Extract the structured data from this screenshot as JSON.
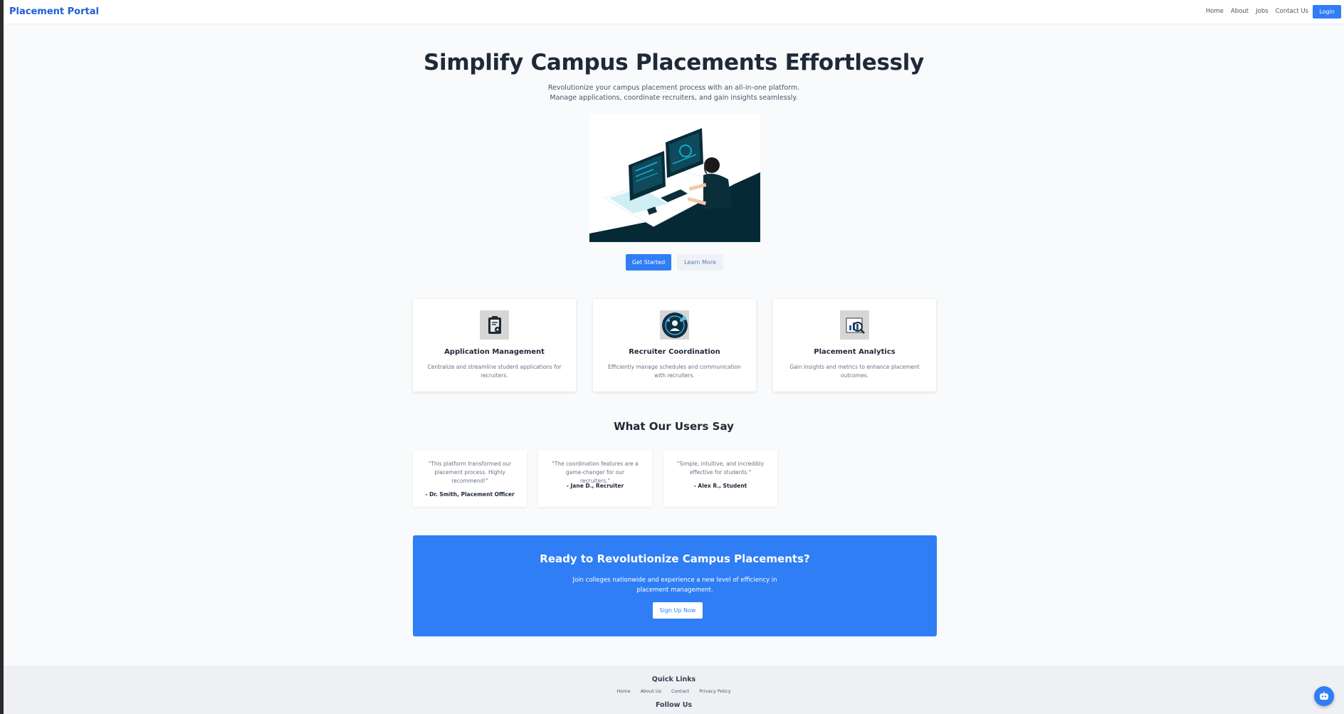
{
  "navbar": {
    "brand": "Placement Portal",
    "links": [
      "Home",
      "About",
      "Jobs",
      "Contact Us"
    ],
    "login_label": "Login"
  },
  "hero": {
    "title": "Simplify Campus Placements Effortlessly",
    "subtitle_line1": "Revolutionize your campus placement process with an all-in-one platform.",
    "subtitle_line2": "Manage applications, coordinate recruiters, and gain insights seamlessly.",
    "primary_button": "Get Started",
    "secondary_button": "Learn More"
  },
  "features": [
    {
      "title": "Application Management",
      "description": "Centralize and streamline student applications for recruiters.",
      "icon": "clipboard-icon"
    },
    {
      "title": "Recruiter Coordination",
      "description": "Efficiently manage schedules and communication with recruiters.",
      "icon": "recruiter-coordination-icon"
    },
    {
      "title": "Placement Analytics",
      "description": "Gain insights and metrics to enhance placement outcomes.",
      "icon": "analytics-icon"
    }
  ],
  "testimonials": {
    "title": "What Our Users Say",
    "items": [
      {
        "quote": "\"This platform transformed our placement process. Highly recommend!\"",
        "author": "- Dr. Smith, Placement Officer"
      },
      {
        "quote": "\"The coordination features are a game-changer for our recruiters.\"",
        "author": "- Jane D., Recruiter"
      },
      {
        "quote": "\"Simple, intuitive, and incredibly effective for students.\"",
        "author": "- Alex R., Student"
      }
    ]
  },
  "cta": {
    "title": "Ready to Revolutionize Campus Placements?",
    "subtitle": "Join colleges nationwide and experience a new level of efficiency in placement management.",
    "button": "Sign Up Now"
  },
  "footer": {
    "quick_links_title": "Quick Links",
    "links": [
      "Home",
      "About Us",
      "Contact",
      "Privacy Policy"
    ],
    "follow_title": "Follow Us"
  },
  "colors": {
    "primary": "#2f7ef5",
    "brand": "#1d5fd6",
    "illustration_dark": "#062a35",
    "screen_cyan": "#1aa7c9"
  }
}
